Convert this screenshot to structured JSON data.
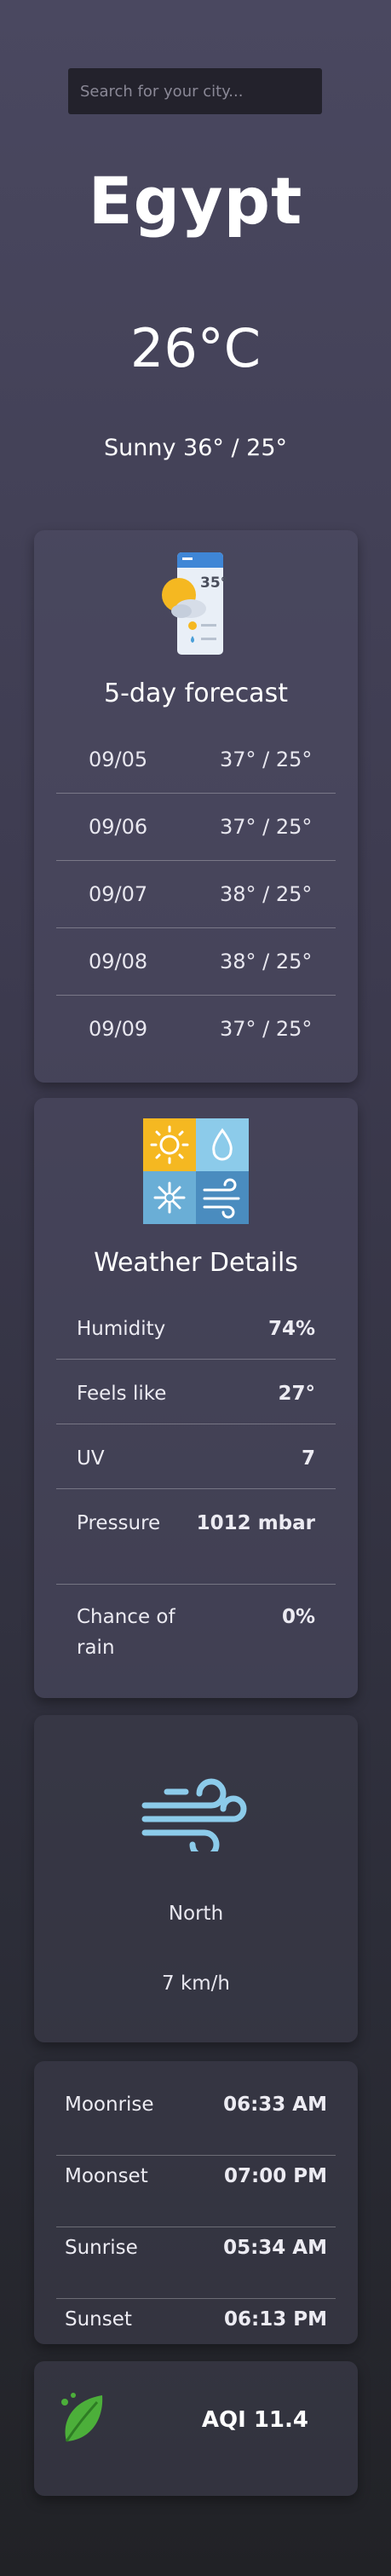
{
  "search": {
    "placeholder": "Search for your city..."
  },
  "location": {
    "city": "Egypt"
  },
  "current": {
    "temperature": "26°C",
    "condition": "Sunny",
    "high_low": "36° / 25°"
  },
  "forecast": {
    "icon_label": "35°",
    "title": "5-day forecast",
    "days": [
      {
        "date": "09/05",
        "temps": "37° / 25°"
      },
      {
        "date": "09/06",
        "temps": "37° / 25°"
      },
      {
        "date": "09/07",
        "temps": "38° / 25°"
      },
      {
        "date": "09/08",
        "temps": "38° / 25°"
      },
      {
        "date": "09/09",
        "temps": "37° / 25°"
      }
    ]
  },
  "details": {
    "title": "Weather Details",
    "rows": [
      {
        "label": "Humidity",
        "value": "74%"
      },
      {
        "label": "Feels like",
        "value": "27°"
      },
      {
        "label": "UV",
        "value": "7"
      },
      {
        "label": "Pressure",
        "value": "1012 mbar"
      },
      {
        "label": "Chance of rain",
        "value": "0%"
      }
    ]
  },
  "wind": {
    "direction": "North",
    "speed": "7 km/h"
  },
  "astro": {
    "rows": [
      {
        "label": "Moonrise",
        "value": "06:33 AM"
      },
      {
        "label": "Moonset",
        "value": "07:00 PM"
      },
      {
        "label": "Sunrise",
        "value": "05:34 AM"
      },
      {
        "label": "Sunset",
        "value": "06:13 PM"
      }
    ]
  },
  "air_quality": {
    "label": "AQI 11.4"
  },
  "icons": {
    "forecast": "forecast-app-icon",
    "details": "weather-tiles-icon",
    "wind": "wind-icon",
    "aqi": "leaf-icon"
  },
  "colors": {
    "accent_yellow": "#f5b821",
    "accent_blue": "#4a9fd8",
    "leaf_green": "#4caf3a"
  }
}
